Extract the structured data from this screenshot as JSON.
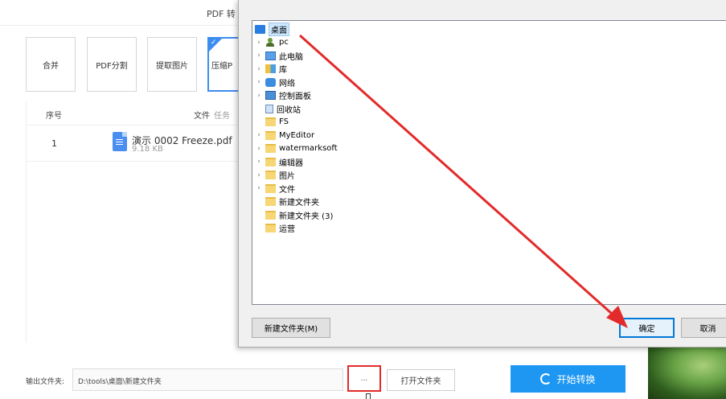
{
  "app": {
    "title": "PDF 转",
    "tools": [
      {
        "label": "合并"
      },
      {
        "label": "PDF分割"
      },
      {
        "label": "提取图片"
      },
      {
        "label": "压缩P"
      }
    ],
    "table": {
      "col_index": "序号",
      "col_file": "文件",
      "col_task": "任务",
      "rows": [
        {
          "index": "1",
          "name": "演示 0002 Freeze.pdf",
          "size": "9.18 KB"
        }
      ]
    },
    "output": {
      "label": "输出文件夹:",
      "path": "D:\\tools\\桌面\\新建文件夹",
      "browse_label": "...",
      "open_folder_label": "打开文件夹",
      "convert_label": "开始转换"
    }
  },
  "dialog": {
    "tree": [
      {
        "label": "桌面",
        "icon": "desktop-icon",
        "expandable": false,
        "selected": true
      },
      {
        "label": "pc",
        "icon": "user-icon",
        "expandable": true
      },
      {
        "label": "此电脑",
        "icon": "computer-icon",
        "expandable": true
      },
      {
        "label": "库",
        "icon": "library-icon",
        "expandable": true
      },
      {
        "label": "网络",
        "icon": "network-icon",
        "expandable": true
      },
      {
        "label": "控制面板",
        "icon": "control-panel-icon",
        "expandable": true
      },
      {
        "label": "回收站",
        "icon": "recycle-bin-icon",
        "expandable": false
      },
      {
        "label": "FS",
        "icon": "folder-icon",
        "expandable": false
      },
      {
        "label": "MyEditor",
        "icon": "folder-icon",
        "expandable": true
      },
      {
        "label": "watermarksoft",
        "icon": "folder-icon",
        "expandable": true
      },
      {
        "label": "编辑器",
        "icon": "folder-icon",
        "expandable": true
      },
      {
        "label": "图片",
        "icon": "folder-icon",
        "expandable": true
      },
      {
        "label": "文件",
        "icon": "folder-icon",
        "expandable": true
      },
      {
        "label": "新建文件夹",
        "icon": "folder-icon",
        "expandable": false
      },
      {
        "label": "新建文件夹 (3)",
        "icon": "folder-icon",
        "expandable": false
      },
      {
        "label": "运营",
        "icon": "folder-icon",
        "expandable": false
      }
    ],
    "new_folder_label": "新建文件夹(M)",
    "ok_label": "确定",
    "cancel_label": "取消"
  },
  "colors": {
    "accent": "#1e97f3",
    "annotation": "#e32a2a",
    "selection": "#cce8ff"
  }
}
